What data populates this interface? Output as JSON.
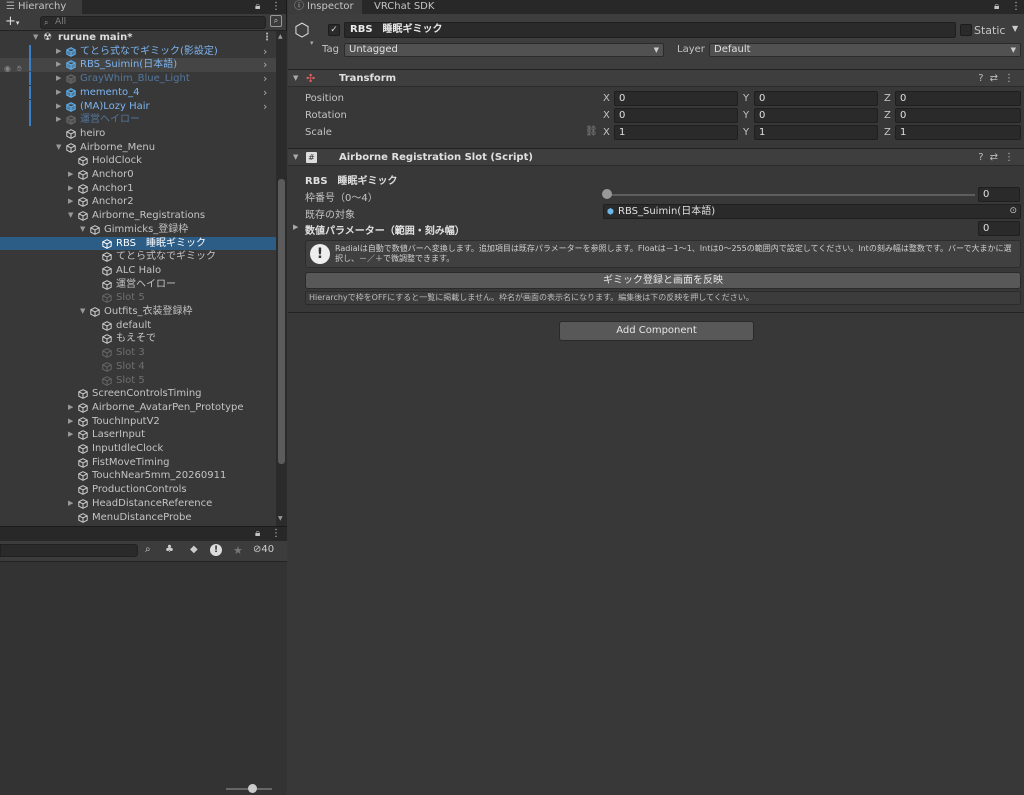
{
  "hierarchy": {
    "tab_label": "Hierarchy",
    "add_label": "+",
    "search_placeholder": "All",
    "root": "rurune main*",
    "rows": [
      {
        "label": "てとら式なでギミック(影設定)",
        "indent": 1,
        "style": "prefab",
        "arrow": "▶",
        "chev": true,
        "bar": true
      },
      {
        "label": "RBS_Suimin(日本語)",
        "indent": 1,
        "style": "prefab hover",
        "arrow": "▶",
        "chev": true,
        "bar": true
      },
      {
        "label": "GrayWhim_Blue_Light",
        "indent": 1,
        "style": "prefabdis",
        "arrow": "▶",
        "chev": true,
        "bar": true
      },
      {
        "label": "memento_4",
        "indent": 1,
        "style": "prefab",
        "arrow": "▶",
        "chev": true,
        "bar": true
      },
      {
        "label": "(MA)Lozy Hair",
        "indent": 1,
        "style": "prefab",
        "arrow": "▶",
        "chev": true,
        "bar": true
      },
      {
        "label": "運営ヘイロー",
        "indent": 1,
        "style": "prefabdis",
        "arrow": "▶",
        "chev": false,
        "bar": true
      },
      {
        "label": "heiro",
        "indent": 1,
        "style": "",
        "arrow": "",
        "chev": false,
        "bar": false
      },
      {
        "label": "Airborne_Menu",
        "indent": 1,
        "style": "",
        "arrow": "▼",
        "chev": false,
        "bar": false
      },
      {
        "label": "HoldClock",
        "indent": 2,
        "style": "",
        "arrow": "",
        "chev": false,
        "bar": false
      },
      {
        "label": "Anchor0",
        "indent": 2,
        "style": "",
        "arrow": "▶",
        "chev": false,
        "bar": false
      },
      {
        "label": "Anchor1",
        "indent": 2,
        "style": "",
        "arrow": "▶",
        "chev": false,
        "bar": false
      },
      {
        "label": "Anchor2",
        "indent": 2,
        "style": "",
        "arrow": "▶",
        "chev": false,
        "bar": false
      },
      {
        "label": "Airborne_Registrations",
        "indent": 2,
        "style": "",
        "arrow": "▼",
        "chev": false,
        "bar": false
      },
      {
        "label": "Gimmicks_登録枠",
        "indent": 3,
        "style": "",
        "arrow": "▼",
        "chev": false,
        "bar": false
      },
      {
        "label": "RBS　睡眠ギミック",
        "indent": 4,
        "style": "sel",
        "arrow": "",
        "chev": false,
        "bar": false
      },
      {
        "label": "てとら式なでギミック",
        "indent": 4,
        "style": "",
        "arrow": "",
        "chev": false,
        "bar": false
      },
      {
        "label": "ALC Halo",
        "indent": 4,
        "style": "",
        "arrow": "",
        "chev": false,
        "bar": false
      },
      {
        "label": "運営ヘイロー",
        "indent": 4,
        "style": "",
        "arrow": "",
        "chev": false,
        "bar": false
      },
      {
        "label": "Slot 5",
        "indent": 4,
        "style": "dis",
        "arrow": "",
        "chev": false,
        "bar": false
      },
      {
        "label": "Outfits_衣装登録枠",
        "indent": 3,
        "style": "",
        "arrow": "▼",
        "chev": false,
        "bar": false
      },
      {
        "label": "default",
        "indent": 4,
        "style": "",
        "arrow": "",
        "chev": false,
        "bar": false
      },
      {
        "label": "もえそで",
        "indent": 4,
        "style": "",
        "arrow": "",
        "chev": false,
        "bar": false
      },
      {
        "label": "Slot 3",
        "indent": 4,
        "style": "dis",
        "arrow": "",
        "chev": false,
        "bar": false
      },
      {
        "label": "Slot 4",
        "indent": 4,
        "style": "dis",
        "arrow": "",
        "chev": false,
        "bar": false
      },
      {
        "label": "Slot 5",
        "indent": 4,
        "style": "dis",
        "arrow": "",
        "chev": false,
        "bar": false
      },
      {
        "label": "ScreenControlsTiming",
        "indent": 2,
        "style": "",
        "arrow": "",
        "chev": false,
        "bar": false
      },
      {
        "label": "Airborne_AvatarPen_Prototype",
        "indent": 2,
        "style": "",
        "arrow": "▶",
        "chev": false,
        "bar": false
      },
      {
        "label": "TouchInputV2",
        "indent": 2,
        "style": "",
        "arrow": "▶",
        "chev": false,
        "bar": false
      },
      {
        "label": "LaserInput",
        "indent": 2,
        "style": "",
        "arrow": "▶",
        "chev": false,
        "bar": false
      },
      {
        "label": "InputIdleClock",
        "indent": 2,
        "style": "",
        "arrow": "",
        "chev": false,
        "bar": false
      },
      {
        "label": "FistMoveTiming",
        "indent": 2,
        "style": "",
        "arrow": "",
        "chev": false,
        "bar": false
      },
      {
        "label": "TouchNear5mm_20260911",
        "indent": 2,
        "style": "",
        "arrow": "",
        "chev": false,
        "bar": false
      },
      {
        "label": "ProductionControls",
        "indent": 2,
        "style": "",
        "arrow": "",
        "chev": false,
        "bar": false
      },
      {
        "label": "HeadDistanceReference",
        "indent": 2,
        "style": "",
        "arrow": "▶",
        "chev": false,
        "bar": false
      },
      {
        "label": "MenuDistanceProbe",
        "indent": 2,
        "style": "",
        "arrow": "",
        "chev": false,
        "bar": false
      }
    ]
  },
  "project": {
    "hidden_count": "40"
  },
  "inspector": {
    "tab_inspector": "Inspector",
    "tab_sdk": "VRChat SDK",
    "object_name": "RBS　睡眠ギミック",
    "static_label": "Static",
    "tag_label": "Tag",
    "tag_value": "Untagged",
    "layer_label": "Layer",
    "layer_value": "Default",
    "transform": {
      "title": "Transform",
      "position_label": "Position",
      "rotation_label": "Rotation",
      "scale_label": "Scale",
      "position": {
        "x": "0",
        "y": "0",
        "z": "0"
      },
      "rotation": {
        "x": "0",
        "y": "0",
        "z": "0"
      },
      "scale": {
        "x": "1",
        "y": "1",
        "z": "1"
      }
    },
    "script": {
      "title": "Airborne Registration Slot (Script)",
      "heading": "RBS　睡眠ギミック",
      "slot_label": "枠番号（0～4）",
      "slot_value": "0",
      "target_label": "既存の対象",
      "target_value": "RBS_Suimin(日本語)",
      "param_label": "数値パラメーター（範囲・刻み幅）",
      "param_value": "0",
      "help_text": "Radialは自動で数値バーへ変換します。追加項目は既存パラメーターを参照します。Floatは－1～1、Intは0～255の範囲内で設定してください。Intの刻み幅は整数です。バーで大まかに選択し、－／＋で微調整できます。",
      "apply_button": "ギミック登録と画面を反映",
      "note_text": "Hierarchyで枠をOFFにすると一覧に掲載しません。枠名が画面の表示名になります。編集後は下の反映を押してください。"
    },
    "add_component": "Add Component"
  },
  "axis_labels": {
    "x": "X",
    "y": "Y",
    "z": "Z"
  }
}
